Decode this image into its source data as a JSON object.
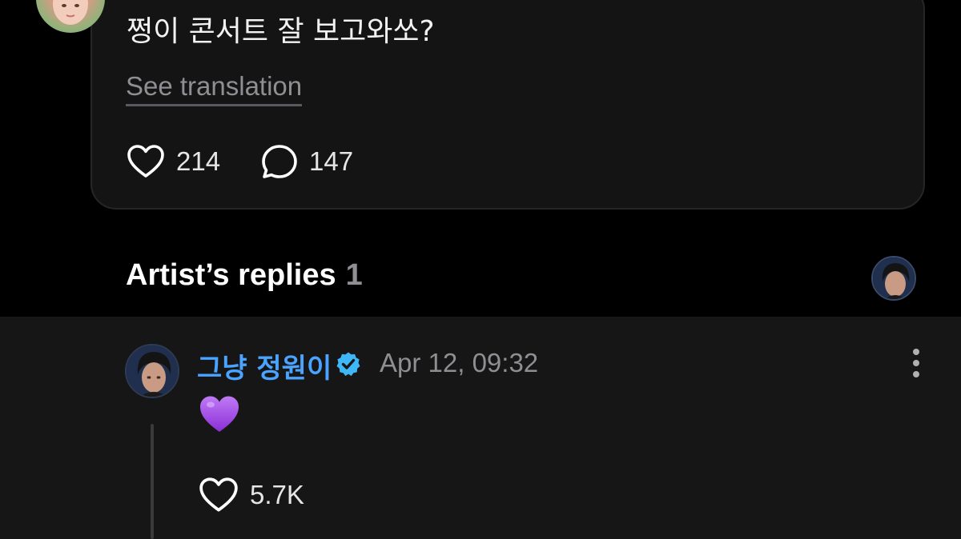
{
  "post": {
    "text": "쩡이 콘서트 잘 보고와쏘?",
    "see_translation": "See translation",
    "likes": "214",
    "comments": "147"
  },
  "artist_replies": {
    "title": "Artist’s replies",
    "count": "1"
  },
  "reply": {
    "author": "그냥 정원이",
    "timestamp": "Apr 12, 09:32",
    "content_emoji": "purple-heart",
    "likes": "5.7K"
  },
  "icons": {
    "like": "heart-outline-icon",
    "comment": "speech-bubble-icon",
    "verified": "verified-badge-icon",
    "more": "more-vertical-icon"
  },
  "colors": {
    "background": "#000000",
    "card": "#141414",
    "reply_panel": "#161616",
    "author_name": "#4aa3ff",
    "verified_badge": "#3fb6f5",
    "muted_text": "#8e8e93",
    "emoji_heart": "#a64ee8"
  }
}
